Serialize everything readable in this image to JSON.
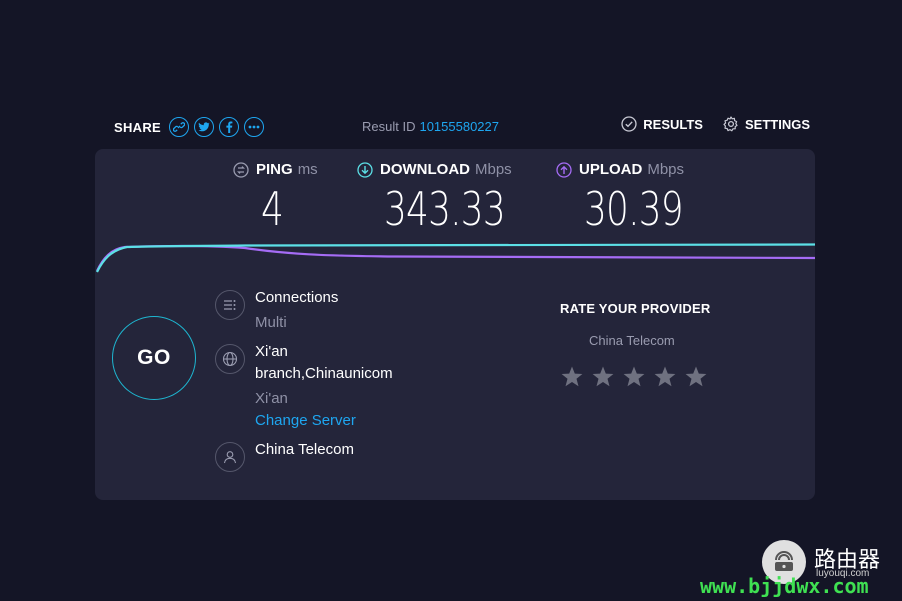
{
  "share": {
    "label": "SHARE",
    "icons": [
      "link-icon",
      "twitter-icon",
      "facebook-icon",
      "more-icon"
    ]
  },
  "result": {
    "label": "Result ID",
    "id": "10155580227"
  },
  "nav": {
    "results": "RESULTS",
    "settings": "SETTINGS"
  },
  "metrics": {
    "ping": {
      "label": "PING",
      "unit": "ms",
      "value": "4"
    },
    "download": {
      "label": "DOWNLOAD",
      "unit": "Mbps",
      "value": "343.33"
    },
    "upload": {
      "label": "UPLOAD",
      "unit": "Mbps",
      "value": "30.39"
    }
  },
  "go_label": "GO",
  "connection": {
    "title": "Connections",
    "mode": "Multi",
    "server_name": "Xi'an",
    "server_sponsor": "branch,Chinaunicom",
    "server_location": "Xi'an",
    "change_server": "Change Server",
    "isp": "China Telecom"
  },
  "rating": {
    "title": "RATE YOUR PROVIDER",
    "provider": "China Telecom",
    "stars_max": 5,
    "stars_selected": 0
  },
  "watermark": {
    "url": "www.bjjdwx.com",
    "cn": "路由器",
    "sub": "luyouqi.com"
  },
  "colors": {
    "background": "#141526",
    "card": "#24253a",
    "accent": "#1ea6f0",
    "download": "#5ce0e6",
    "upload": "#a56cf5",
    "go_ring": "#1eb6d0"
  }
}
